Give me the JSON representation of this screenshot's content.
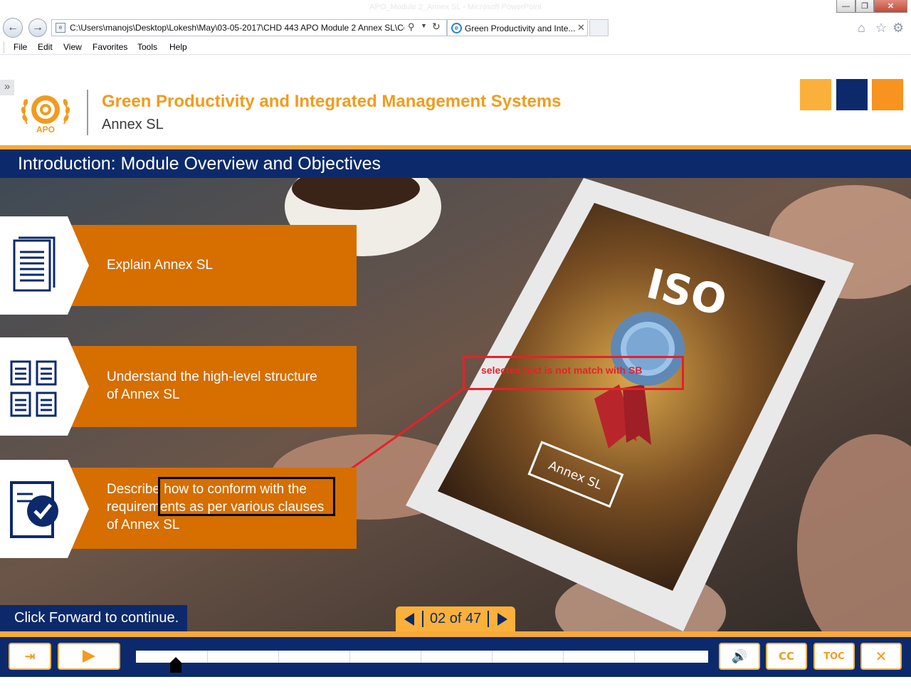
{
  "browser": {
    "window_title": "APO_Module 2_Annex SL - Microsoft PowerPoint",
    "address": "C:\\Users\\manojs\\Desktop\\Lokesh\\May\\03-05-2017\\CHD 443 APO Module 2 Annex SL\\Co",
    "tab_title": "Green Productivity and Inte...",
    "menu": [
      "File",
      "Edit",
      "View",
      "Favorites",
      "Tools",
      "Help"
    ]
  },
  "course": {
    "logo_text": "APO",
    "title": "Green Productivity and Integrated Management Systems",
    "subtitle": "Annex SL",
    "accent_colors": [
      "#fbb03b",
      "#0c2a6b",
      "#f7931e"
    ]
  },
  "slide": {
    "title": "Introduction: Module Overview and Objectives",
    "tablet_brand": "ISO",
    "tablet_label": "Annex SL",
    "objectives": [
      {
        "icon": "document-icon",
        "line1": "Explain Annex SL",
        "line2": "",
        "line3": ""
      },
      {
        "icon": "multiple-documents-icon",
        "line1": "Understand the high-level structure",
        "line2": "of Annex SL",
        "line3": ""
      },
      {
        "icon": "checklist-icon",
        "line1": "Describe how to conform with the",
        "line2": "requirements as per various clauses",
        "line3": "of Annex SL"
      }
    ],
    "annotation": "selected text is not match with SB",
    "continue_prompt": "Click Forward to continue."
  },
  "pager": {
    "text": "02 of 47",
    "current": 2,
    "total": 47
  },
  "player": {
    "progress": 0.07,
    "cc_label": "CC",
    "toc_label": "TOC"
  },
  "colors": {
    "orange": "#d66e00",
    "navy": "#0c2a6b",
    "gold": "#fbb03b",
    "annotation_red": "#e8202a"
  }
}
